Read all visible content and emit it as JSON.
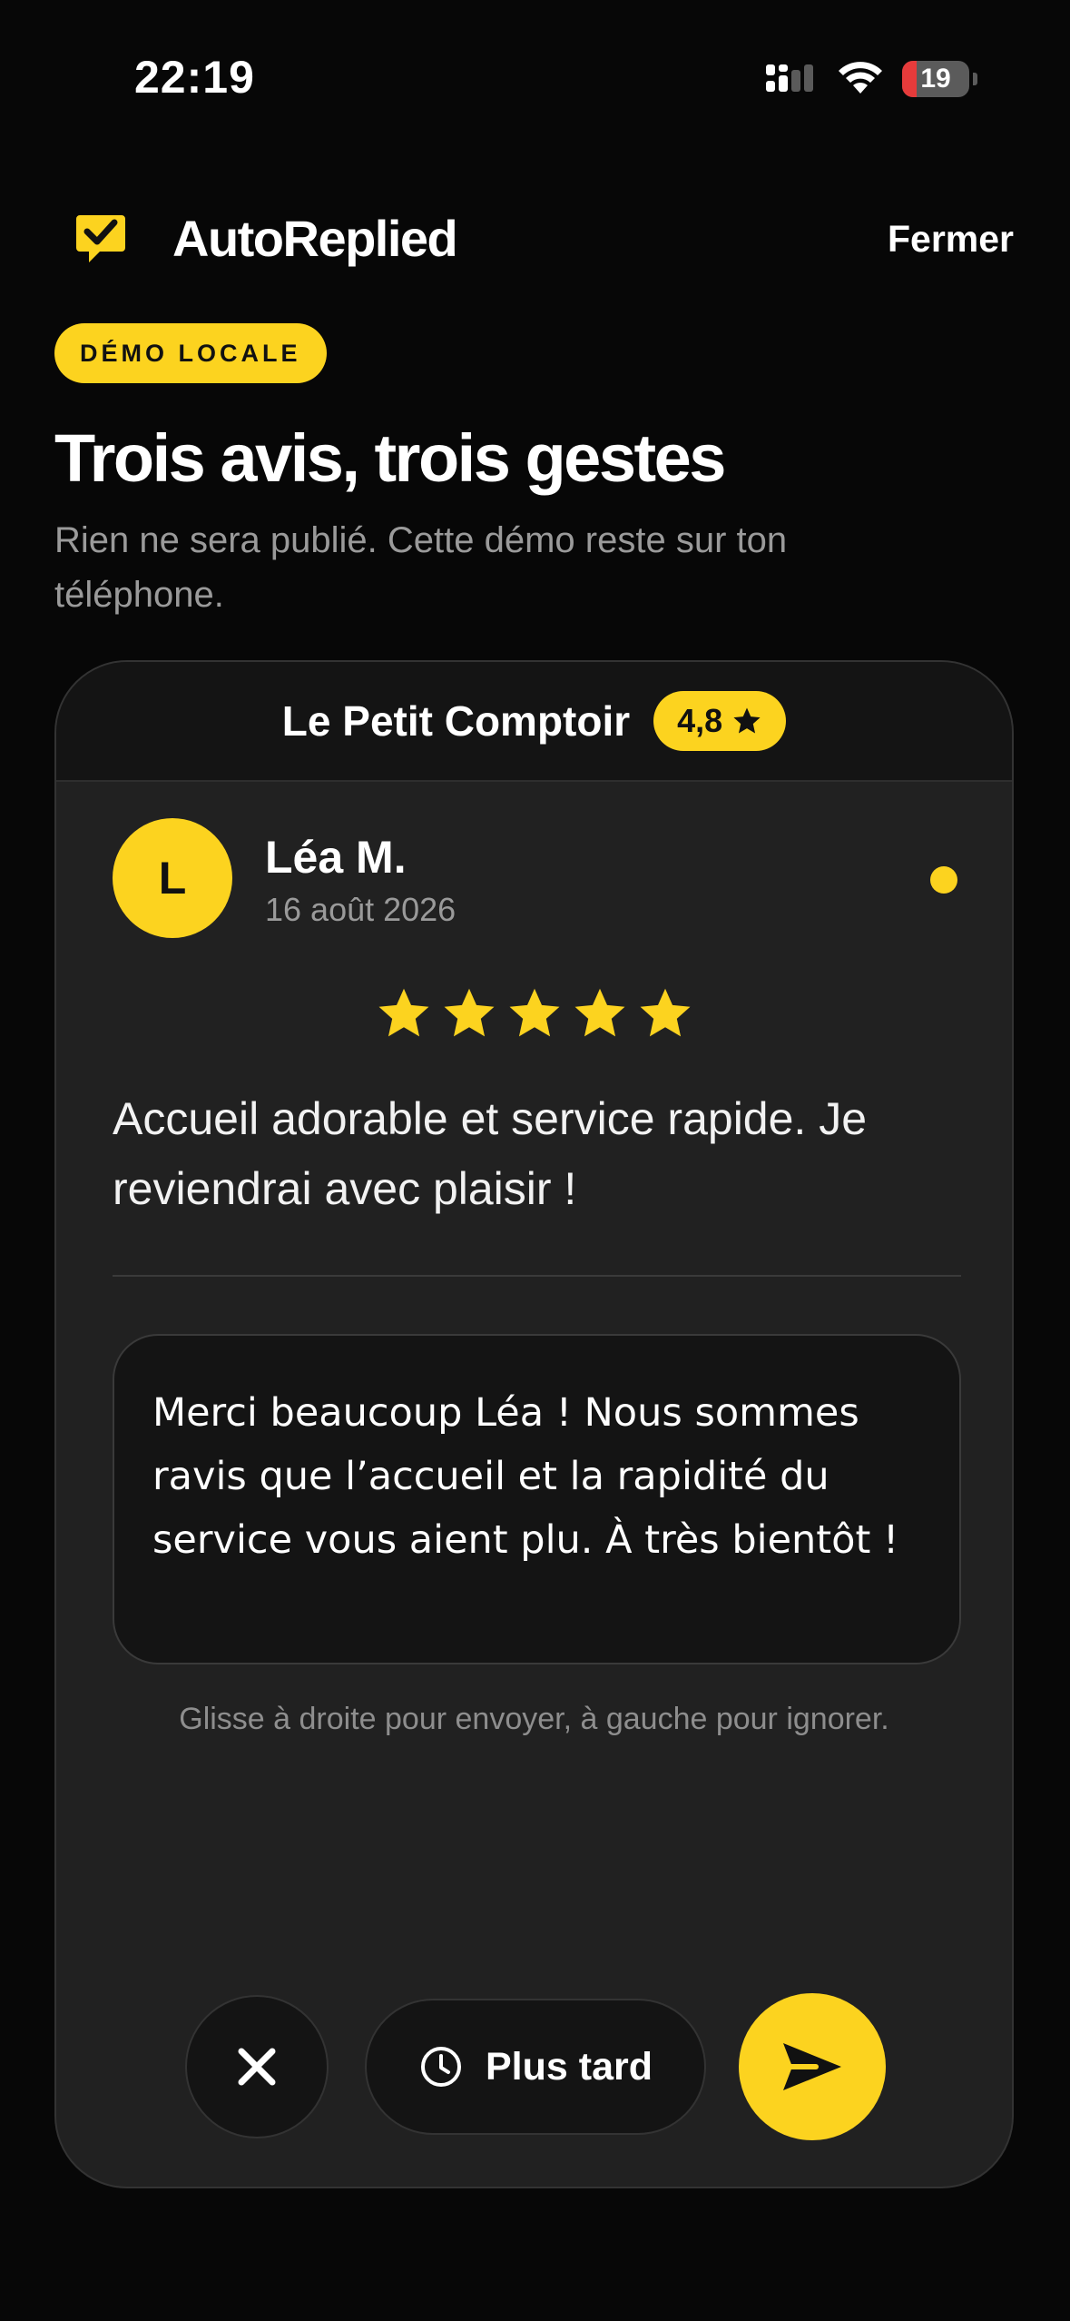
{
  "status_bar": {
    "time": "22:19",
    "battery": "19",
    "icons": [
      "signal-icon",
      "wifi-icon",
      "battery-icon"
    ]
  },
  "header": {
    "app_name": "AutoReplied",
    "close_label": "Fermer",
    "logo_icon": "chat-check-icon"
  },
  "badge": "DÉMO LOCALE",
  "title": "Trois avis, trois gestes",
  "subtitle": "Rien ne sera publié. Cette démo reste sur ton téléphone.",
  "card": {
    "place_name": "Le Petit Comptoir",
    "place_rating": "4,8",
    "review": {
      "avatar_initial": "L",
      "author": "Léa M.",
      "date": "16 août 2026",
      "stars": 5,
      "text": "Accueil adorable et service rapide. Je reviendrai avec plaisir !"
    },
    "reply": "Merci beaucoup Léa ! Nous sommes ravis que l’accueil et la rapidité du service vous aient plu. À très bientôt !",
    "hint": "Glisse à droite pour envoyer, à gauche pour ignorer.",
    "actions": {
      "later_label": "Plus tard"
    }
  },
  "colors": {
    "background": "#070707",
    "accent": "#fcd31f",
    "card": "#212121"
  }
}
